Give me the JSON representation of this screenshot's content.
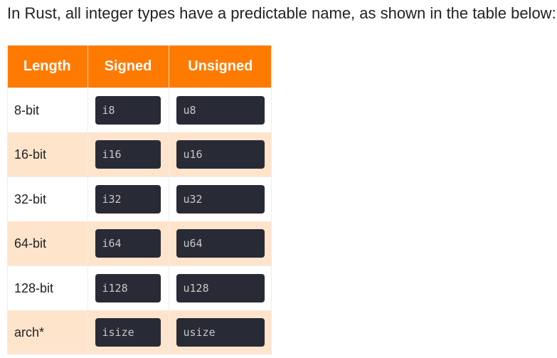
{
  "intro_text": "In Rust, all integer types have a predictable name, as shown in the table below:",
  "table": {
    "headers": [
      "Length",
      "Signed",
      "Unsigned"
    ],
    "rows": [
      {
        "length": "8-bit",
        "signed": "i8",
        "unsigned": "u8"
      },
      {
        "length": "16-bit",
        "signed": "i16",
        "unsigned": "u16"
      },
      {
        "length": "32-bit",
        "signed": "i32",
        "unsigned": "u32"
      },
      {
        "length": "64-bit",
        "signed": "i64",
        "unsigned": "u64"
      },
      {
        "length": "128-bit",
        "signed": "i128",
        "unsigned": "u128"
      },
      {
        "length": "arch*",
        "signed": "isize",
        "unsigned": "usize"
      }
    ]
  },
  "colors": {
    "header_bg": "#ff7a00",
    "row_alt_bg": "#ffe4cc",
    "code_bg": "#282a36"
  }
}
